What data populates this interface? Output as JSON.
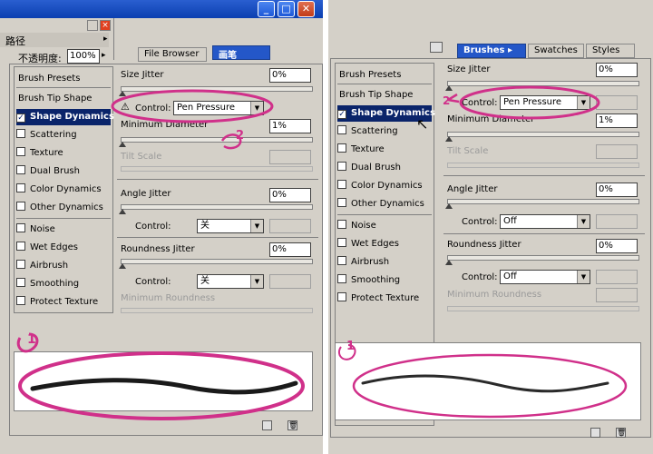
{
  "left": {
    "path_tab": "路径",
    "opacity_label": "不透明度:",
    "opacity_value": "100%",
    "tabs": [
      "File Browser",
      "画笔"
    ],
    "sections": {
      "brush_presets": "Brush Presets",
      "brush_tip_shape": "Brush Tip Shape"
    },
    "options": [
      {
        "label": "Shape Dynamics",
        "checked": true,
        "selected": true
      },
      {
        "label": "Scattering",
        "checked": false
      },
      {
        "label": "Texture",
        "checked": false
      },
      {
        "label": "Dual Brush",
        "checked": false
      },
      {
        "label": "Color Dynamics",
        "checked": false
      },
      {
        "label": "Other Dynamics",
        "checked": false
      },
      {
        "label": "Noise",
        "checked": false
      },
      {
        "label": "Wet Edges",
        "checked": false
      },
      {
        "label": "Airbrush",
        "checked": false
      },
      {
        "label": "Smoothing",
        "checked": false
      },
      {
        "label": "Protect Texture",
        "checked": false
      }
    ],
    "size_jitter": {
      "label": "Size Jitter",
      "value": "0%"
    },
    "control1": {
      "label": "Control:",
      "value": "Pen Pressure"
    },
    "min_diameter": {
      "label": "Minimum Diameter",
      "value": "1%"
    },
    "tilt_scale": {
      "label": "Tilt Scale"
    },
    "angle_jitter": {
      "label": "Angle Jitter",
      "value": "0%"
    },
    "control2": {
      "label": "Control:",
      "value": "关"
    },
    "roundness_jitter": {
      "label": "Roundness Jitter",
      "value": "0%"
    },
    "control3": {
      "label": "Control:",
      "value": "关"
    },
    "min_roundness": {
      "label": "Minimum Roundness"
    }
  },
  "right": {
    "tabs": [
      "Brushes",
      "Swatches",
      "Styles"
    ],
    "sections": {
      "brush_presets": "Brush Presets",
      "brush_tip_shape": "Brush Tip Shape"
    },
    "options": [
      {
        "label": "Shape Dynamics",
        "checked": true,
        "selected": true
      },
      {
        "label": "Scattering",
        "checked": false
      },
      {
        "label": "Texture",
        "checked": false
      },
      {
        "label": "Dual Brush",
        "checked": false
      },
      {
        "label": "Color Dynamics",
        "checked": false
      },
      {
        "label": "Other Dynamics",
        "checked": false
      },
      {
        "label": "Noise",
        "checked": false
      },
      {
        "label": "Wet Edges",
        "checked": false
      },
      {
        "label": "Airbrush",
        "checked": false
      },
      {
        "label": "Smoothing",
        "checked": false
      },
      {
        "label": "Protect Texture",
        "checked": false
      }
    ],
    "size_jitter": {
      "label": "Size Jitter",
      "value": "0%"
    },
    "control1": {
      "label": "Control:",
      "value": "Pen Pressure"
    },
    "min_diameter": {
      "label": "Minimum Diameter",
      "value": "1%"
    },
    "tilt_scale": {
      "label": "Tilt Scale"
    },
    "angle_jitter": {
      "label": "Angle Jitter",
      "value": "0%"
    },
    "control2": {
      "label": "Control:",
      "value": "Off"
    },
    "roundness_jitter": {
      "label": "Roundness Jitter",
      "value": "0%"
    },
    "control3": {
      "label": "Control:",
      "value": "Off"
    },
    "min_roundness": {
      "label": "Minimum Roundness"
    }
  },
  "annotations": {
    "one": "1",
    "two": "2",
    "annotation_color": "#d0308a"
  }
}
